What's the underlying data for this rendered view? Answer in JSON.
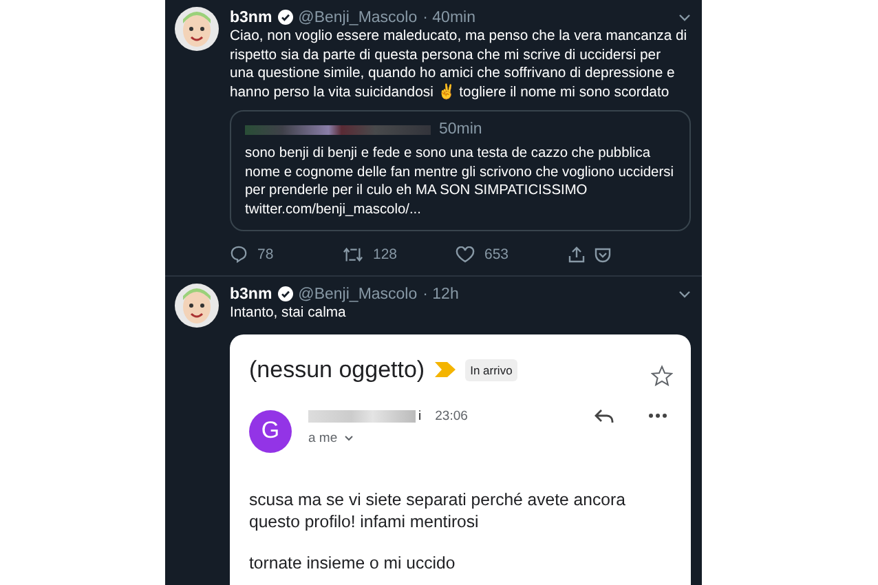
{
  "tweets": [
    {
      "name": "b3nm",
      "verified": true,
      "handle": "@Benji_Mascolo",
      "time": "· 40min",
      "text": "Ciao, non voglio essere maleducato, ma penso che la vera mancanza di rispetto sia da parte di questa persona che mi scrive di uccidersi per una questione simile, quando ho amici che soffrivano di depressione e hanno perso la vita suicidandosi ✌️ togliere il nome mi sono scordato",
      "quote": {
        "time": "50min",
        "text": "sono benji di benji e fede e sono una testa de cazzo che pubblica nome e cognome delle fan mentre gli scrivono che vogliono uccidersi per prenderle per il culo eh MA SON SIMPATICISSIMO",
        "link": "twitter.com/benji_mascolo/..."
      },
      "actions": {
        "replies": "78",
        "retweets": "128",
        "likes": "653"
      }
    },
    {
      "name": "b3nm",
      "verified": true,
      "handle": "@Benji_Mascolo",
      "time": "· 12h",
      "text": "Intanto, stai calma",
      "email": {
        "subject": "(nessun oggetto)",
        "important": true,
        "label": "In arrivo",
        "starred": false,
        "avatar_letter": "G",
        "sender_visible": "i",
        "time": "23:06",
        "recipient": "a me",
        "body": [
          "scusa ma se vi siete separati perché avete ancora questo profilo! infami mentirosi",
          "tornate insieme o mi uccido"
        ]
      }
    }
  ]
}
